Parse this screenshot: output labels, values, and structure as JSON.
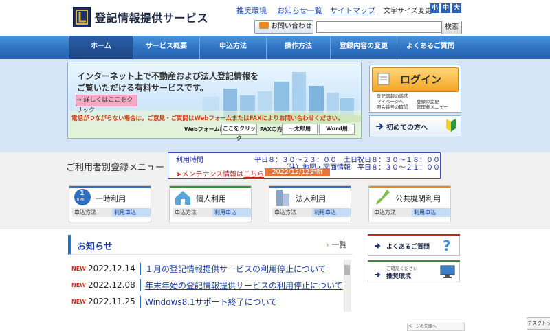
{
  "header": {
    "site_title": "登記情報提供サービス",
    "links": [
      "推奨環境",
      "お知らせ一覧",
      "サイトマップ"
    ],
    "fontsize_label": "文字サイズ変更",
    "fontsize_options": [
      "小",
      "中",
      "大"
    ],
    "contact_label": "お問い合わせ",
    "search_placeholder": "",
    "search_button": "検索"
  },
  "nav": {
    "tabs": [
      "ホーム",
      "サービス概要",
      "申込方法",
      "操作方法",
      "登録内容の変更",
      "よくあるご質問"
    ],
    "active": "ホーム"
  },
  "hero": {
    "line1": "インターネット上で不動産および法人登記情報を",
    "line2": "ご覧いただける有料サービスです。",
    "detail_button": "→ 詳しくはここをクリック",
    "notice": "電話がつながらない場合は，ご意見・ご質問はWebフォームまたはFAXによりお問い合わせください。",
    "webform_label": "Webフォームは",
    "webform_button": "ここをクリック",
    "fax_label": "FAXの方",
    "fax_buttons": [
      "一太郎用",
      "Word用"
    ]
  },
  "login": {
    "label": "ログイン",
    "sub_items": [
      "登記情報の請求",
      "マイページへ",
      "照会番号の確認",
      "登録の変更",
      "管理者メニュー"
    ],
    "firsttime_label": "初めての方へ"
  },
  "registration": {
    "title": "ご利用者別登録メニュー",
    "info_label": "利用時間",
    "info_line1": "平日８：３０～２３：００　土日祝日８：３０～１８：００",
    "info_line2": "（注）地図・図面情報　平日８：３０～２１：００",
    "maint_text_prefix": "➤メンテナンス情報は",
    "maint_link": "こちら",
    "maint_badge": "2022/12/12更新",
    "cards": [
      {
        "title": "一時利用",
        "icon_text": "1",
        "icon_sub": "TIME",
        "btn_a": "申込方法",
        "btn_b": "利用申込"
      },
      {
        "title": "個人利用",
        "btn_a": "申込方法",
        "btn_b": "利用申込"
      },
      {
        "title": "法人利用",
        "btn_a": "申込方法",
        "btn_b": "利用申込"
      },
      {
        "title": "公共機関利用",
        "btn_a": "申込方法",
        "btn_b": "利用申込"
      }
    ]
  },
  "news": {
    "title": "お知らせ",
    "more": "一覧",
    "items": [
      {
        "badge": "NEW",
        "date": "2022.12.14",
        "text": "１月の登記情報提供サービスの利用停止について"
      },
      {
        "badge": "NEW",
        "date": "2022.12.08",
        "text": "年末年始の登記情報提供サービスの利用停止について"
      },
      {
        "badge": "NEW",
        "date": "2022.11.25",
        "text": "Windows8.1サポート終了について"
      }
    ]
  },
  "side": {
    "faq_label": "よくあるご質問",
    "env_label_small": "ご確認ください",
    "env_label": "推奨環境"
  },
  "misc": {
    "bottom_tab": "ページの先頭へ",
    "desktop_tab": "デスクトップ"
  }
}
